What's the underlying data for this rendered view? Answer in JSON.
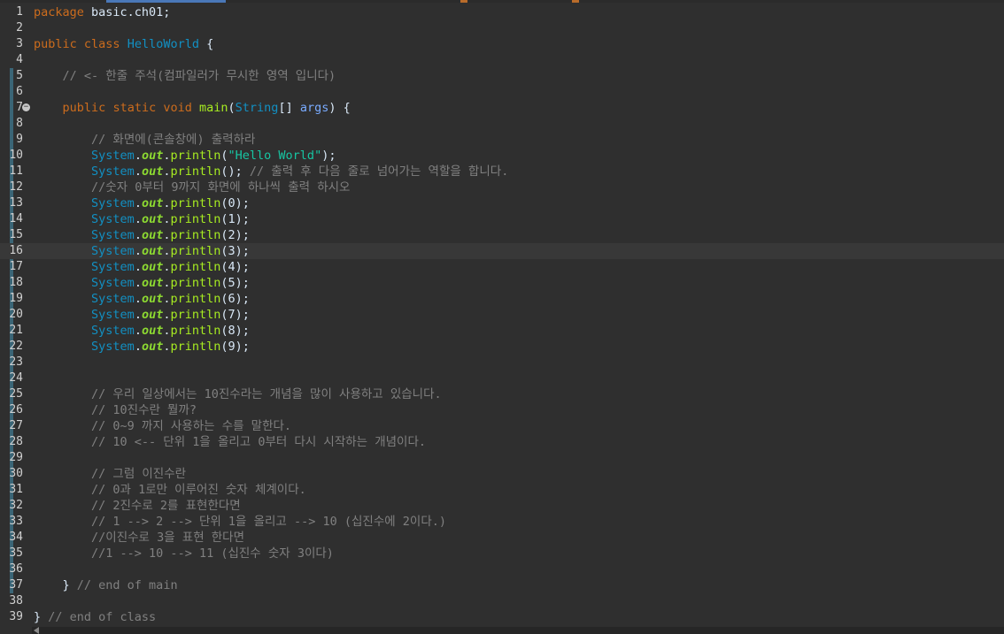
{
  "current_line": 16,
  "lines": [
    {
      "n": "1",
      "tokens": [
        [
          "kw",
          "package"
        ],
        [
          "plain",
          " basic.ch01;"
        ]
      ]
    },
    {
      "n": "2",
      "tokens": []
    },
    {
      "n": "3",
      "tokens": [
        [
          "kw",
          "public"
        ],
        [
          "plain",
          " "
        ],
        [
          "kw",
          "class"
        ],
        [
          "plain",
          " "
        ],
        [
          "cls",
          "HelloWorld"
        ],
        [
          "plain",
          " {"
        ]
      ]
    },
    {
      "n": "4",
      "tokens": []
    },
    {
      "n": "5",
      "tokens": [
        [
          "plain",
          "    "
        ],
        [
          "cmt",
          "// <- 한줄 주석(컴파일러가 무시한 영역 입니다)"
        ]
      ]
    },
    {
      "n": "6",
      "tokens": []
    },
    {
      "n": "7",
      "fold": true,
      "tokens": [
        [
          "plain",
          "    "
        ],
        [
          "kw",
          "public"
        ],
        [
          "plain",
          " "
        ],
        [
          "kw",
          "static"
        ],
        [
          "plain",
          " "
        ],
        [
          "kw",
          "void"
        ],
        [
          "plain",
          " "
        ],
        [
          "meth",
          "main"
        ],
        [
          "plain",
          "("
        ],
        [
          "cls",
          "String"
        ],
        [
          "plain",
          "[] "
        ],
        [
          "param",
          "args"
        ],
        [
          "plain",
          ") {"
        ]
      ]
    },
    {
      "n": "8",
      "tokens": []
    },
    {
      "n": "9",
      "tokens": [
        [
          "plain",
          "        "
        ],
        [
          "cmt",
          "// 화면에(콘솔창에) 출력하라"
        ]
      ]
    },
    {
      "n": "10",
      "tokens": [
        [
          "plain",
          "        "
        ],
        [
          "cls",
          "System"
        ],
        [
          "plain",
          "."
        ],
        [
          "fld",
          "out"
        ],
        [
          "plain",
          "."
        ],
        [
          "meth",
          "println"
        ],
        [
          "plain",
          "("
        ],
        [
          "str",
          "\"Hello World\""
        ],
        [
          "plain",
          ");"
        ]
      ]
    },
    {
      "n": "11",
      "tokens": [
        [
          "plain",
          "        "
        ],
        [
          "cls",
          "System"
        ],
        [
          "plain",
          "."
        ],
        [
          "fld",
          "out"
        ],
        [
          "plain",
          "."
        ],
        [
          "meth",
          "println"
        ],
        [
          "plain",
          "(); "
        ],
        [
          "cmt",
          "// 출력 후 다음 줄로 넘어가는 역할을 합니다."
        ]
      ]
    },
    {
      "n": "12",
      "tokens": [
        [
          "plain",
          "        "
        ],
        [
          "cmt",
          "//숫자 0부터 9까지 화면에 하나씩 출력 하시오"
        ]
      ]
    },
    {
      "n": "13",
      "tokens": [
        [
          "plain",
          "        "
        ],
        [
          "cls",
          "System"
        ],
        [
          "plain",
          "."
        ],
        [
          "fld",
          "out"
        ],
        [
          "plain",
          "."
        ],
        [
          "meth",
          "println"
        ],
        [
          "plain",
          "(0);"
        ]
      ]
    },
    {
      "n": "14",
      "tokens": [
        [
          "plain",
          "        "
        ],
        [
          "cls",
          "System"
        ],
        [
          "plain",
          "."
        ],
        [
          "fld",
          "out"
        ],
        [
          "plain",
          "."
        ],
        [
          "meth",
          "println"
        ],
        [
          "plain",
          "(1);"
        ]
      ]
    },
    {
      "n": "15",
      "tokens": [
        [
          "plain",
          "        "
        ],
        [
          "cls",
          "System"
        ],
        [
          "plain",
          "."
        ],
        [
          "fld",
          "out"
        ],
        [
          "plain",
          "."
        ],
        [
          "meth",
          "println"
        ],
        [
          "plain",
          "(2);"
        ]
      ]
    },
    {
      "n": "16",
      "tokens": [
        [
          "plain",
          "        "
        ],
        [
          "cls",
          "System"
        ],
        [
          "plain",
          "."
        ],
        [
          "fld",
          "out"
        ],
        [
          "plain",
          "."
        ],
        [
          "meth",
          "println"
        ],
        [
          "plain",
          "(3);"
        ]
      ]
    },
    {
      "n": "17",
      "tokens": [
        [
          "plain",
          "        "
        ],
        [
          "cls",
          "System"
        ],
        [
          "plain",
          "."
        ],
        [
          "fld",
          "out"
        ],
        [
          "plain",
          "."
        ],
        [
          "meth",
          "println"
        ],
        [
          "plain",
          "(4);"
        ]
      ]
    },
    {
      "n": "18",
      "tokens": [
        [
          "plain",
          "        "
        ],
        [
          "cls",
          "System"
        ],
        [
          "plain",
          "."
        ],
        [
          "fld",
          "out"
        ],
        [
          "plain",
          "."
        ],
        [
          "meth",
          "println"
        ],
        [
          "plain",
          "(5);"
        ]
      ]
    },
    {
      "n": "19",
      "tokens": [
        [
          "plain",
          "        "
        ],
        [
          "cls",
          "System"
        ],
        [
          "plain",
          "."
        ],
        [
          "fld",
          "out"
        ],
        [
          "plain",
          "."
        ],
        [
          "meth",
          "println"
        ],
        [
          "plain",
          "(6);"
        ]
      ]
    },
    {
      "n": "20",
      "tokens": [
        [
          "plain",
          "        "
        ],
        [
          "cls",
          "System"
        ],
        [
          "plain",
          "."
        ],
        [
          "fld",
          "out"
        ],
        [
          "plain",
          "."
        ],
        [
          "meth",
          "println"
        ],
        [
          "plain",
          "(7);"
        ]
      ]
    },
    {
      "n": "21",
      "tokens": [
        [
          "plain",
          "        "
        ],
        [
          "cls",
          "System"
        ],
        [
          "plain",
          "."
        ],
        [
          "fld",
          "out"
        ],
        [
          "plain",
          "."
        ],
        [
          "meth",
          "println"
        ],
        [
          "plain",
          "(8);"
        ]
      ]
    },
    {
      "n": "22",
      "tokens": [
        [
          "plain",
          "        "
        ],
        [
          "cls",
          "System"
        ],
        [
          "plain",
          "."
        ],
        [
          "fld",
          "out"
        ],
        [
          "plain",
          "."
        ],
        [
          "meth",
          "println"
        ],
        [
          "plain",
          "(9);"
        ]
      ]
    },
    {
      "n": "23",
      "tokens": []
    },
    {
      "n": "24",
      "tokens": []
    },
    {
      "n": "25",
      "tokens": [
        [
          "plain",
          "        "
        ],
        [
          "cmt",
          "// 우리 일상에서는 10진수라는 개념을 많이 사용하고 있습니다."
        ]
      ]
    },
    {
      "n": "26",
      "tokens": [
        [
          "plain",
          "        "
        ],
        [
          "cmt",
          "// 10진수란 뭘까?"
        ]
      ]
    },
    {
      "n": "27",
      "tokens": [
        [
          "plain",
          "        "
        ],
        [
          "cmt",
          "// 0~9 까지 사용하는 수를 말한다."
        ]
      ]
    },
    {
      "n": "28",
      "tokens": [
        [
          "plain",
          "        "
        ],
        [
          "cmt",
          "// 10 <-- 단위 1을 올리고 0부터 다시 시작하는 개념이다."
        ]
      ]
    },
    {
      "n": "29",
      "tokens": []
    },
    {
      "n": "30",
      "tokens": [
        [
          "plain",
          "        "
        ],
        [
          "cmt",
          "// 그럼 이진수란"
        ]
      ]
    },
    {
      "n": "31",
      "tokens": [
        [
          "plain",
          "        "
        ],
        [
          "cmt",
          "// 0과 1로만 이루어진 숫자 체계이다."
        ]
      ]
    },
    {
      "n": "32",
      "tokens": [
        [
          "plain",
          "        "
        ],
        [
          "cmt",
          "// 2진수로 2를 표현한다면"
        ]
      ]
    },
    {
      "n": "33",
      "tokens": [
        [
          "plain",
          "        "
        ],
        [
          "cmt",
          "// 1 --> 2 --> 단위 1을 올리고 --> 10 (십진수에 2이다.)"
        ]
      ]
    },
    {
      "n": "34",
      "tokens": [
        [
          "plain",
          "        "
        ],
        [
          "cmt",
          "//이진수로 3을 표현 한다면"
        ]
      ]
    },
    {
      "n": "35",
      "tokens": [
        [
          "plain",
          "        "
        ],
        [
          "cmt",
          "//1 --> 10 --> 11 (십진수 숫자 3이다)"
        ]
      ]
    },
    {
      "n": "36",
      "tokens": []
    },
    {
      "n": "37",
      "tokens": [
        [
          "plain",
          "    } "
        ],
        [
          "cmt",
          "// end of main"
        ]
      ]
    },
    {
      "n": "38",
      "tokens": []
    },
    {
      "n": "39",
      "tokens": [
        [
          "plain",
          "} "
        ],
        [
          "cmt",
          "// end of class"
        ]
      ]
    }
  ]
}
